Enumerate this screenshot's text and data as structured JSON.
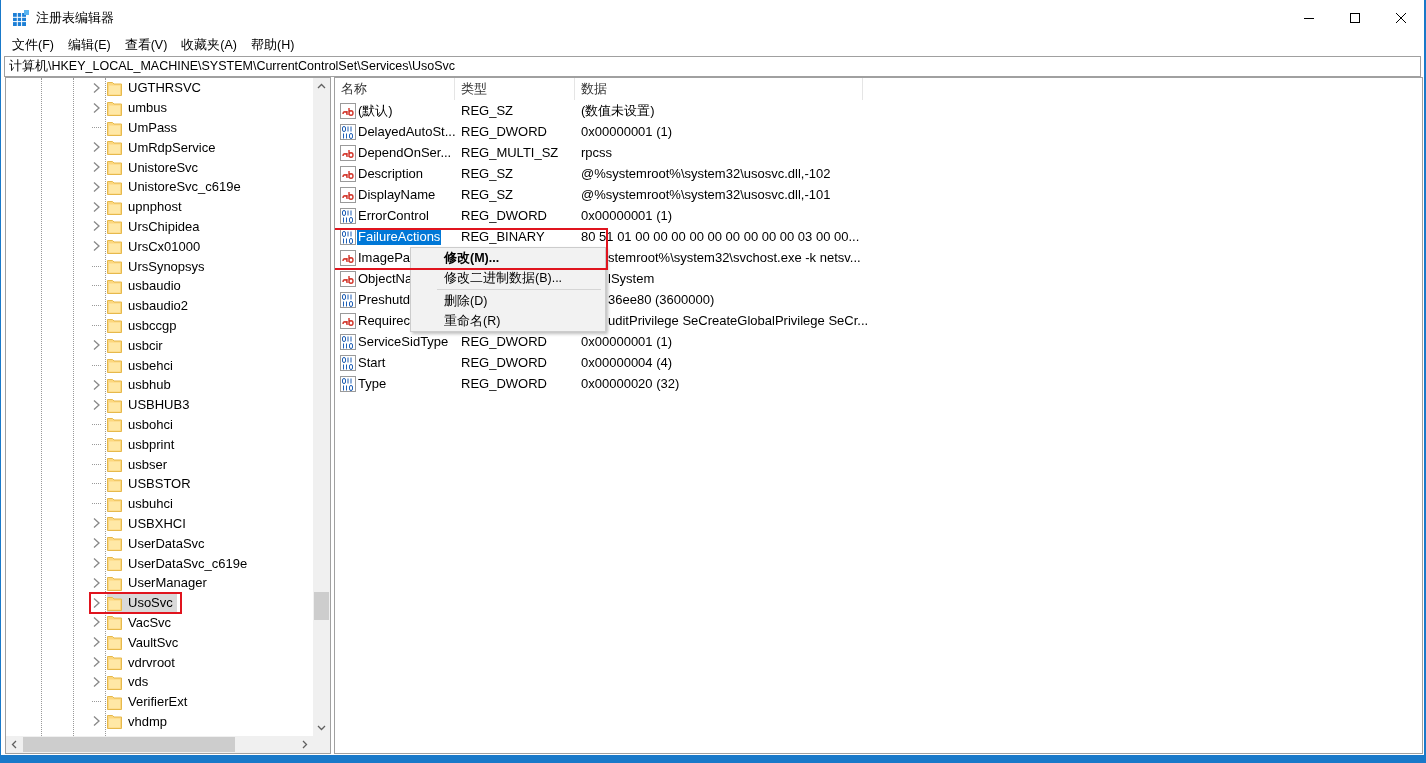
{
  "window": {
    "title": "注册表编辑器"
  },
  "menu_bar": [
    {
      "label": "文件(F)"
    },
    {
      "label": "编辑(E)"
    },
    {
      "label": "查看(V)"
    },
    {
      "label": "收藏夹(A)"
    },
    {
      "label": "帮助(H)"
    }
  ],
  "address_bar": {
    "value": "计算机\\HKEY_LOCAL_MACHINE\\SYSTEM\\CurrentControlSet\\Services\\UsoSvc"
  },
  "tree": {
    "items": [
      {
        "label": "UGTHRSVC",
        "expandable": true,
        "selected": false,
        "outlined": false
      },
      {
        "label": "umbus",
        "expandable": true,
        "selected": false,
        "outlined": false
      },
      {
        "label": "UmPass",
        "expandable": false,
        "selected": false,
        "outlined": false
      },
      {
        "label": "UmRdpService",
        "expandable": true,
        "selected": false,
        "outlined": false
      },
      {
        "label": "UnistoreSvc",
        "expandable": true,
        "selected": false,
        "outlined": false
      },
      {
        "label": "UnistoreSvc_c619e",
        "expandable": true,
        "selected": false,
        "outlined": false
      },
      {
        "label": "upnphost",
        "expandable": true,
        "selected": false,
        "outlined": false
      },
      {
        "label": "UrsChipidea",
        "expandable": true,
        "selected": false,
        "outlined": false
      },
      {
        "label": "UrsCx01000",
        "expandable": true,
        "selected": false,
        "outlined": false
      },
      {
        "label": "UrsSynopsys",
        "expandable": false,
        "selected": false,
        "outlined": false
      },
      {
        "label": "usbaudio",
        "expandable": false,
        "selected": false,
        "outlined": false
      },
      {
        "label": "usbaudio2",
        "expandable": false,
        "selected": false,
        "outlined": false
      },
      {
        "label": "usbccgp",
        "expandable": false,
        "selected": false,
        "outlined": false
      },
      {
        "label": "usbcir",
        "expandable": true,
        "selected": false,
        "outlined": false
      },
      {
        "label": "usbehci",
        "expandable": false,
        "selected": false,
        "outlined": false
      },
      {
        "label": "usbhub",
        "expandable": true,
        "selected": false,
        "outlined": false
      },
      {
        "label": "USBHUB3",
        "expandable": true,
        "selected": false,
        "outlined": false
      },
      {
        "label": "usbohci",
        "expandable": false,
        "selected": false,
        "outlined": false
      },
      {
        "label": "usbprint",
        "expandable": false,
        "selected": false,
        "outlined": false
      },
      {
        "label": "usbser",
        "expandable": false,
        "selected": false,
        "outlined": false
      },
      {
        "label": "USBSTOR",
        "expandable": false,
        "selected": false,
        "outlined": false
      },
      {
        "label": "usbuhci",
        "expandable": false,
        "selected": false,
        "outlined": false
      },
      {
        "label": "USBXHCI",
        "expandable": true,
        "selected": false,
        "outlined": false
      },
      {
        "label": "UserDataSvc",
        "expandable": true,
        "selected": false,
        "outlined": false
      },
      {
        "label": "UserDataSvc_c619e",
        "expandable": true,
        "selected": false,
        "outlined": false
      },
      {
        "label": "UserManager",
        "expandable": true,
        "selected": false,
        "outlined": false
      },
      {
        "label": "UsoSvc",
        "expandable": true,
        "selected": true,
        "outlined": true
      },
      {
        "label": "VacSvc",
        "expandable": true,
        "selected": false,
        "outlined": false
      },
      {
        "label": "VaultSvc",
        "expandable": true,
        "selected": false,
        "outlined": false
      },
      {
        "label": "vdrvroot",
        "expandable": true,
        "selected": false,
        "outlined": false
      },
      {
        "label": "vds",
        "expandable": true,
        "selected": false,
        "outlined": false
      },
      {
        "label": "VerifierExt",
        "expandable": false,
        "selected": false,
        "outlined": false
      },
      {
        "label": "vhdmp",
        "expandable": true,
        "selected": false,
        "outlined": false
      }
    ]
  },
  "values": {
    "columns": [
      "名称",
      "类型",
      "数据"
    ],
    "rows": [
      {
        "kind": "string",
        "name": "(默认)",
        "type": "REG_SZ",
        "data": "(数值未设置)",
        "selected": false
      },
      {
        "kind": "binary",
        "name": "DelayedAutoSt...",
        "type": "REG_DWORD",
        "data": "0x00000001 (1)",
        "selected": false
      },
      {
        "kind": "string",
        "name": "DependOnSer...",
        "type": "REG_MULTI_SZ",
        "data": "rpcss",
        "selected": false
      },
      {
        "kind": "string",
        "name": "Description",
        "type": "REG_SZ",
        "data": "@%systemroot%\\system32\\usosvc.dll,-102",
        "selected": false
      },
      {
        "kind": "string",
        "name": "DisplayName",
        "type": "REG_SZ",
        "data": "@%systemroot%\\system32\\usosvc.dll,-101",
        "selected": false
      },
      {
        "kind": "binary",
        "name": "ErrorControl",
        "type": "REG_DWORD",
        "data": "0x00000001 (1)",
        "selected": false
      },
      {
        "kind": "binary",
        "name": "FailureActions",
        "type": "REG_BINARY",
        "data": "80 51 01 00 00 00 00 00 00 00 00 00 03 00 00...",
        "selected": true
      },
      {
        "kind": "string",
        "name": "ImagePa",
        "data": "stemroot%\\system32\\svchost.exe -k netsv...",
        "selected": false
      },
      {
        "kind": "string",
        "name": "ObjectNa",
        "data": "lSystem",
        "selected": false
      },
      {
        "kind": "binary",
        "name": "Preshutd",
        "data": "36ee80 (3600000)",
        "selected": false
      },
      {
        "kind": "string",
        "name": "Requirec",
        "data": "uditPrivilege SeCreateGlobalPrivilege SeCr...",
        "selected": false
      },
      {
        "kind": "binary",
        "name": "ServiceSidType",
        "type": "REG_DWORD",
        "data": "0x00000001 (1)",
        "selected": false
      },
      {
        "kind": "binary",
        "name": "Start",
        "type": "REG_DWORD",
        "data": "0x00000004 (4)",
        "selected": false
      },
      {
        "kind": "binary",
        "name": "Type",
        "type": "REG_DWORD",
        "data": "0x00000020 (32)",
        "selected": false
      }
    ]
  },
  "context_menu": {
    "outlined": true,
    "items": [
      {
        "kind": "item",
        "label": "修改(M)...",
        "default": true
      },
      {
        "kind": "item",
        "label": "修改二进制数据(B)...",
        "default": false
      },
      {
        "kind": "separator"
      },
      {
        "kind": "item",
        "label": "删除(D)",
        "default": false
      },
      {
        "kind": "item",
        "label": "重命名(R)",
        "default": false
      }
    ]
  }
}
